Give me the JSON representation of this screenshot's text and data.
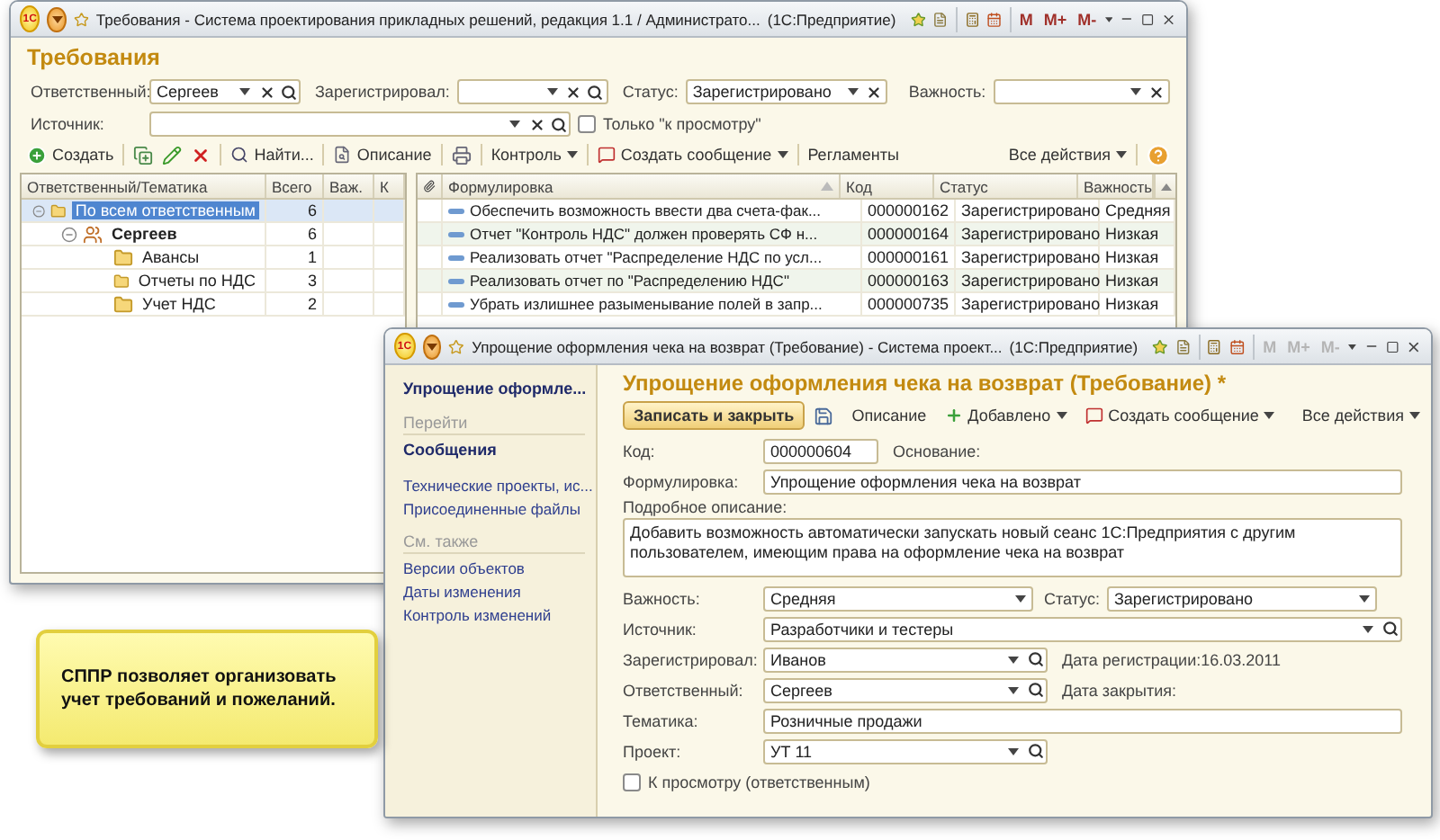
{
  "main_window": {
    "logo": "1С",
    "title": "Требования - Система проектирования прикладных решений, редакция 1.1 / Администрато...",
    "app": "(1С:Предприятие)",
    "memory_buttons": [
      "M",
      "M+",
      "M-"
    ],
    "memory_disabled": false,
    "heading": "Требования",
    "filters": [
      {
        "label": "Ответственный:",
        "value": "Сергеев",
        "kind": "select"
      },
      {
        "label": "Зарегистрировал:",
        "kind": "select"
      },
      {
        "label": "Статус:",
        "value": "Зарегистрировано",
        "kind": "choice"
      },
      {
        "label": "Важность:",
        "kind": "choice"
      },
      {
        "label": "Источник:",
        "kind": "select"
      }
    ],
    "review_only": {
      "label": "Только \"к просмотру\"",
      "checked": false
    },
    "toolbar": [
      {
        "label": "Создать",
        "menu": false
      },
      {
        "label": "Найти...",
        "menu": false
      },
      {
        "label": "Описание",
        "menu": false
      },
      {
        "label": "Контроль",
        "menu": true
      },
      {
        "label": "Создать сообщение",
        "menu": true
      },
      {
        "label": "Регламенты",
        "menu": false
      }
    ],
    "all_actions": "Все действия",
    "tree": {
      "columns": [
        "Ответственный/Тематика",
        "Всего",
        "Важ.",
        "К"
      ],
      "rows": [
        {
          "name": "По всем ответственным",
          "total": "6",
          "kind": "group",
          "selected": true,
          "expanded": true,
          "children": [
            {
              "name": "Сергеев",
              "total": "6",
              "kind": "person",
              "selected": false,
              "expanded": true,
              "children": [
                {
                  "name": "Авансы",
                  "total": "1",
                  "kind": "group",
                  "selected": false
                },
                {
                  "name": "Отчеты по НДС",
                  "total": "3",
                  "kind": "group",
                  "selected": false
                },
                {
                  "name": "Учет НДС",
                  "total": "2",
                  "kind": "group",
                  "selected": false
                }
              ]
            }
          ]
        }
      ]
    },
    "table": {
      "columns": [
        "Формулировка",
        "Код",
        "Статус",
        "Важность"
      ],
      "rows": [
        {
          "text": "Обеспечить возможность ввести два счета-фак...",
          "code": "000000162",
          "status": "Зарегистрировано",
          "importance": "Средняя"
        },
        {
          "text": "Отчет \"Контроль НДС\" должен проверять СФ н...",
          "code": "000000164",
          "status": "Зарегистрировано",
          "importance": "Низкая"
        },
        {
          "text": "Реализовать отчет \"Распределение НДС по усл...",
          "code": "000000161",
          "status": "Зарегистрировано",
          "importance": "Низкая"
        },
        {
          "text": "Реализовать отчет по \"Распределению НДС\"",
          "code": "000000163",
          "status": "Зарегистрировано",
          "importance": "Низкая"
        },
        {
          "text": "Убрать излишнее разыменывание полей в запр...",
          "code": "000000735",
          "status": "Зарегистрировано",
          "importance": "Низкая"
        }
      ]
    }
  },
  "form_window": {
    "logo": "1С",
    "title": "Упрощение оформления чека на возврат (Требование) - Система проект...",
    "app": "(1С:Предприятие)",
    "memory_buttons": [
      "M",
      "M+",
      "M-"
    ],
    "memory_disabled": true,
    "nav": {
      "title": "Упрощение оформле...",
      "sections": [
        {
          "title": "Перейти",
          "items": [
            {
              "label": "Сообщения",
              "selected": true
            },
            {
              "label": "Технические проекты, ис...",
              "selected": false
            },
            {
              "label": "Присоединенные файлы",
              "selected": false
            }
          ]
        },
        {
          "title": "См. также",
          "items": [
            {
              "label": "Версии объектов",
              "selected": false
            },
            {
              "label": "Даты изменения",
              "selected": false
            },
            {
              "label": "Контроль изменений",
              "selected": false
            }
          ]
        }
      ]
    },
    "heading": "Упрощение оформления чека на возврат (Требование) *",
    "toolbar": [
      {
        "label": "Записать и закрыть",
        "kind": "primary"
      },
      {
        "label": "Описание",
        "kind": "plain"
      },
      {
        "label": "Добавлено",
        "kind": "menu"
      },
      {
        "label": "Создать сообщение",
        "kind": "menu"
      }
    ],
    "all_actions": "Все действия",
    "code": {
      "label": "Код:",
      "value": "000000604",
      "kind": "text"
    },
    "basis_label": "Основание:",
    "wording": {
      "label": "Формулировка:",
      "value": "Упрощение оформления чека на возврат",
      "kind": "text"
    },
    "description": {
      "label": "Подробное описание:",
      "value": "Добавить возможность автоматически запускать новый сеанс 1С:Предприятия с другим пользователем, имеющим права на оформление чека на возврат"
    },
    "importance": {
      "label": "Важность:",
      "value": "Средняя",
      "kind": "list"
    },
    "status": {
      "label": "Статус:",
      "value": "Зарегистрировано",
      "kind": "list"
    },
    "source": {
      "label": "Источник:",
      "value": "Разработчики и тестеры",
      "kind": "lookup"
    },
    "registered_by": {
      "label": "Зарегистрировал:",
      "value": "Иванов",
      "kind": "lookup"
    },
    "registration_date": "Дата регистрации:16.03.2011",
    "responsible": {
      "label": "Ответственный:",
      "value": "Сергеев",
      "kind": "lookup"
    },
    "closing_date": "Дата закрытия:",
    "topic": {
      "label": "Тематика:",
      "value": "Розничные продажи",
      "kind": "text"
    },
    "project": {
      "label": "Проект:",
      "value": "УТ 11",
      "kind": "lookup"
    },
    "review": {
      "label": "К просмотру (ответственным)",
      "checked": false
    }
  },
  "callout": {
    "text": "СППР позволяет организовать учет требований и пожеланий."
  }
}
